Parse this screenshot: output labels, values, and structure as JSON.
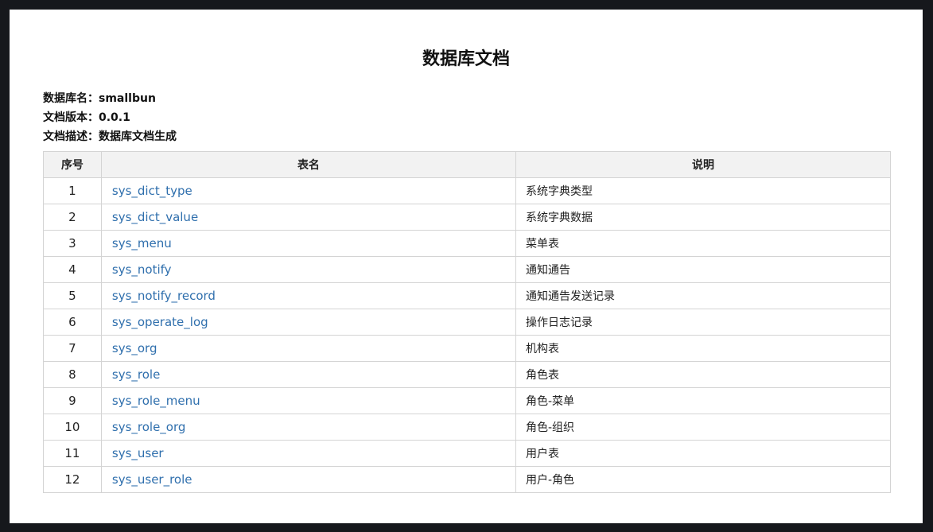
{
  "doc": {
    "title": "数据库文档",
    "db_name_label": "数据库名：",
    "db_name": "smallbun",
    "version_label": "文档版本：",
    "version": "0.0.1",
    "desc_label": "文档描述：",
    "desc": "数据库文档生成"
  },
  "table": {
    "headers": [
      "序号",
      "表名",
      "说明"
    ],
    "rows": [
      {
        "no": "1",
        "name": "sys_dict_type",
        "desc": "系统字典类型"
      },
      {
        "no": "2",
        "name": "sys_dict_value",
        "desc": "系统字典数据"
      },
      {
        "no": "3",
        "name": "sys_menu",
        "desc": "菜单表"
      },
      {
        "no": "4",
        "name": "sys_notify",
        "desc": "通知通告"
      },
      {
        "no": "5",
        "name": "sys_notify_record",
        "desc": "通知通告发送记录"
      },
      {
        "no": "6",
        "name": "sys_operate_log",
        "desc": "操作日志记录"
      },
      {
        "no": "7",
        "name": "sys_org",
        "desc": "机构表"
      },
      {
        "no": "8",
        "name": "sys_role",
        "desc": "角色表"
      },
      {
        "no": "9",
        "name": "sys_role_menu",
        "desc": "角色-菜单"
      },
      {
        "no": "10",
        "name": "sys_role_org",
        "desc": "角色-组织"
      },
      {
        "no": "11",
        "name": "sys_user",
        "desc": "用户表"
      },
      {
        "no": "12",
        "name": "sys_user_role",
        "desc": "用户-角色"
      }
    ]
  },
  "colors": {
    "link": "#2f6fad",
    "header_bg": "#f2f2f2",
    "border": "#d4d4d4",
    "backdrop": "#16181c"
  }
}
